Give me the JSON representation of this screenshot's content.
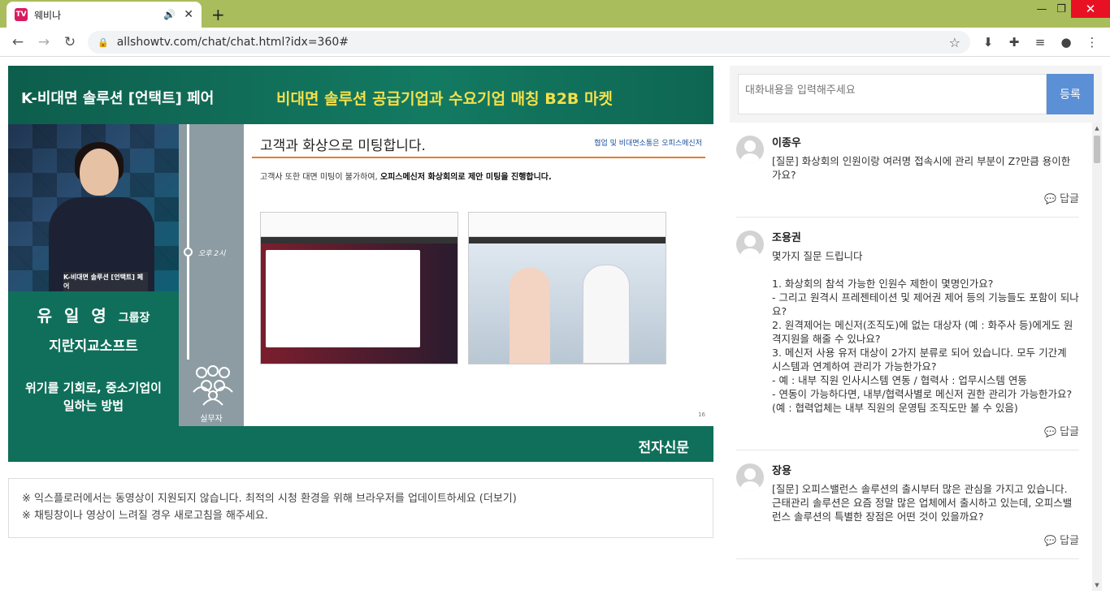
{
  "browser": {
    "tab_title": "웨비나",
    "tab_favicon": "TV",
    "url": "allshowtv.com/chat/chat.html?idx=360#"
  },
  "video": {
    "brand": "K-비대면 솔루션 [언택트] 페어",
    "slogan": "비대면 솔루션 공급기업과 수요기업 매칭 B2B 마켓",
    "podium": "K-비대면 솔루션 [언택트] 페어",
    "speaker_name": "유 일 영",
    "speaker_title": "그룹장",
    "company": "지란지교소프트",
    "topic": "위기를 기회로, 중소기업이\n일하는 방법",
    "timeline_time": "오후 2시",
    "role": "실무자",
    "slide_title": "고객과 화상으로 미팅합니다.",
    "slide_sub": "협업 및 비대면소통은 오피스메신저",
    "slide_desc_plain": "고객사 또한 대면 미팅이 불가하여, ",
    "slide_desc_bold": "오피스메신저 화상회의로 제안 미팅을 진행합니다.",
    "slide_page": "16",
    "footer_logo": "전자신문"
  },
  "notice": {
    "line1": "※ 익스플로러에서는 동영상이 지원되지 않습니다. 최적의 시청 환경을 위해 브라우저를 업데이트하세요 (더보기)",
    "line2": "※ 채팅창이나 영상이 느려질 경우 새로고침을 해주세요."
  },
  "chat": {
    "placeholder": "대화내용을 입력해주세요",
    "submit_label": "등록",
    "reply_label": "답글",
    "messages": [
      {
        "author": "이종우",
        "text": "[질문] 화상회의 인원이랑 여러명 접속시에 관리 부분이 Z?만큼 용이한가요?"
      },
      {
        "author": "조용권",
        "text": "몇가지 질문 드립니다\n\n1. 화상회의 참석 가능한 인원수 제한이 몇명인가요?\n- 그리고 원격시 프레젠테이션 및 제어권 제어 등의 기능들도 포함이 되나요?\n2. 원격제어는 메신저(조직도)에 없는 대상자 (예 : 화주사 등)에게도 원격지원을 해줄 수 있나요?\n3. 메신저 사용 유저 대상이 2가지 분류로 되어 있습니다. 모두 기간계 시스템과 연계하여 관리가 가능한가요?\n- 예 : 내부 직원 인사시스템 연동 / 협력사 : 업무시스템 연동\n- 연동이 가능하다면, 내부/협력사별로 메신저 권한 관리가 가능한가요?(예 : 협력업체는 내부 직원의 운영팀 조직도만 볼 수 있음)"
      },
      {
        "author": "장용",
        "text": "[질문] 오피스밸런스 솔루션의 출시부터 많은 관심을 가지고 있습니다. 근태관리 솔루션은 요즘 정말 많은 업체에서 출시하고 있는데, 오피스밸런스 솔루션의 특별한 장점은 어떤 것이 있을까요?"
      }
    ]
  }
}
